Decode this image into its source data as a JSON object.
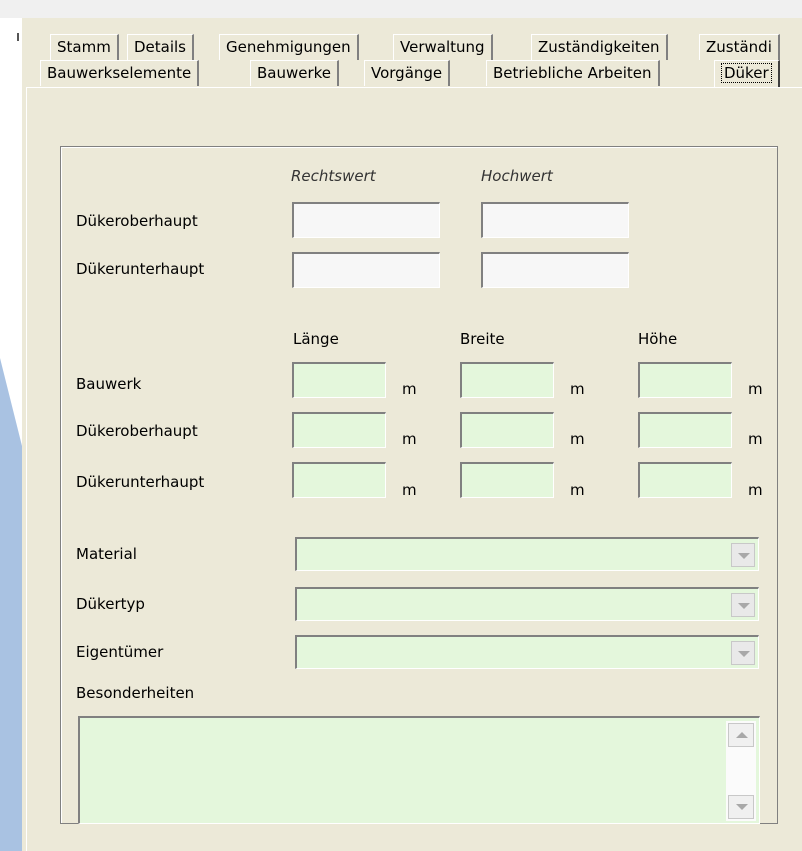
{
  "tabs_row1": [
    "Stamm",
    "Details",
    "Genehmigungen",
    "Verwaltung",
    "Zuständigkeiten",
    "Zuständi"
  ],
  "tabs_row2": [
    "Bauwerkselemente",
    "Bauwerke",
    "Vorgänge",
    "Betriebliche Arbeiten",
    "Düker"
  ],
  "active_tab": "Düker",
  "coords": {
    "col_rechtswert": "Rechtswert",
    "col_hochwert": "Hochwert",
    "rows": [
      "Dükeroberhaupt",
      "Dükerunterhaupt"
    ],
    "values": [
      [
        "",
        ""
      ],
      [
        "",
        ""
      ]
    ]
  },
  "dims": {
    "col_laenge": "Länge",
    "col_breite": "Breite",
    "col_hoehe": "Höhe",
    "unit": "m",
    "rows": [
      "Bauwerk",
      "Dükeroberhaupt",
      "Dükerunterhaupt"
    ]
  },
  "combos": {
    "material_label": "Material",
    "duekertyp_label": "Dükertyp",
    "eigentuemer_label": "Eigentümer",
    "material_value": "",
    "duekertyp_value": "",
    "eigentuemer_value": ""
  },
  "besonderheiten": {
    "label": "Besonderheiten",
    "value": ""
  },
  "colors": {
    "editable_field": "#e4f7dc",
    "readonly_field": "#f7f7f7",
    "window_bg": "#ece9d8",
    "accent_blue": "#a8c0e0"
  }
}
